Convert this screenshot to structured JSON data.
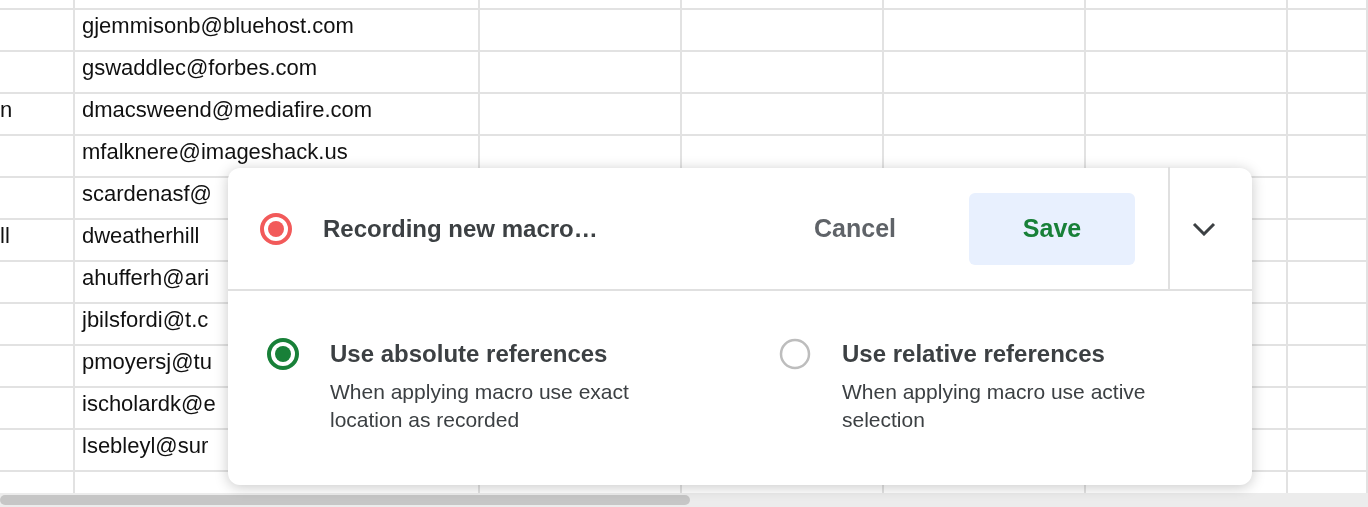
{
  "sheet": {
    "rows": [
      {
        "column_a": "",
        "email": "gjemmisonb@bluehost.com"
      },
      {
        "column_a": "",
        "email": "gswaddlec@forbes.com"
      },
      {
        "column_a": "n",
        "email": "dmacsweend@mediafire.com"
      },
      {
        "column_a": "",
        "email": "mfalknere@imageshack.us"
      },
      {
        "column_a": "",
        "email": "scardenasf@"
      },
      {
        "column_a": "ll",
        "email": "dweatherhill"
      },
      {
        "column_a": "",
        "email": "ahufferh@ari"
      },
      {
        "column_a": "",
        "email": "jbilsfordi@t.c"
      },
      {
        "column_a": "",
        "email": "pmoyersj@tu"
      },
      {
        "column_a": "",
        "email": "ischolardk@e"
      },
      {
        "column_a": "",
        "email": "lsebleyl@sur"
      }
    ]
  },
  "macro_dialog": {
    "status": "Recording new macro…",
    "cancel": "Cancel",
    "save": "Save",
    "options": [
      {
        "title": "Use absolute references",
        "description": "When applying macro use exact location as recorded",
        "selected": true
      },
      {
        "title": "Use relative references",
        "description": "When applying macro use active selection",
        "selected": false
      }
    ]
  }
}
